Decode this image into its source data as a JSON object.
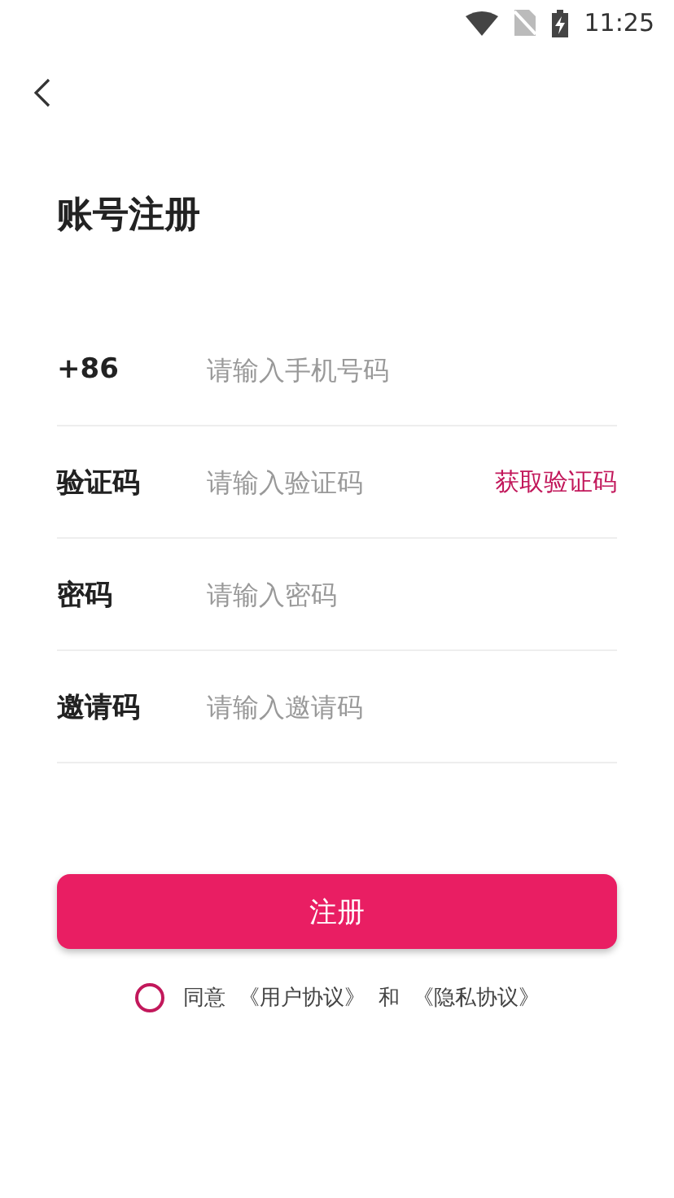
{
  "status_bar": {
    "time": "11:25"
  },
  "title": "账号注册",
  "fields": [
    {
      "label": "+86",
      "placeholder": "请输入手机号码"
    },
    {
      "label": "验证码",
      "placeholder": "请输入验证码",
      "action": "获取验证码"
    },
    {
      "label": "密码",
      "placeholder": "请输入密码"
    },
    {
      "label": "邀请码",
      "placeholder": "请输入邀请码"
    }
  ],
  "submit_button": "注册",
  "agreement": {
    "checked": false,
    "text": "同意",
    "links": [
      "《用户协议》",
      "《隐私协议》"
    ],
    "conjunction": "和"
  }
}
